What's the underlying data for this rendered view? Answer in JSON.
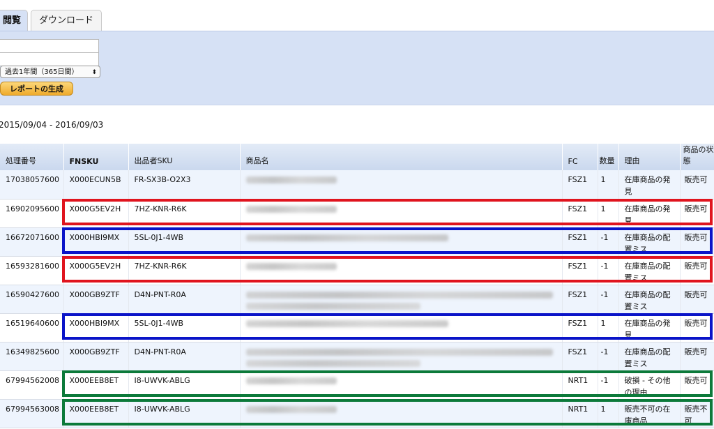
{
  "tabs": [
    {
      "label": "閲覧"
    },
    {
      "label": "ダウンロード"
    }
  ],
  "filters": {
    "period_select": "過去1年間（365日間）",
    "generate_button": "レポートの生成"
  },
  "date_range": "2015/09/04 - 2016/09/03",
  "table": {
    "headers": [
      "処理番号",
      "FNSKU",
      "出品者SKU",
      "商品名",
      "FC",
      "数量",
      "理由",
      "商品の状態"
    ],
    "rows": [
      {
        "id": "17038057600",
        "fnsku": "X000ECUN5B",
        "sku": "FR-SX3B-O2X3",
        "fc": "FSZ1",
        "qty": "1",
        "reason": "在庫商品の発見",
        "status": "販売可",
        "highlight": "none"
      },
      {
        "id": "16902095600",
        "fnsku": "X000G5EV2H",
        "sku": "7HZ-KNR-R6K",
        "fc": "FSZ1",
        "qty": "1",
        "reason": "在庫商品の発見",
        "status": "販売可",
        "highlight": "red"
      },
      {
        "id": "16672071600",
        "fnsku": "X000HBI9MX",
        "sku": "5SL-0J1-4WB",
        "fc": "FSZ1",
        "qty": "-1",
        "reason": "在庫商品の配置ミス",
        "status": "販売可",
        "highlight": "blue"
      },
      {
        "id": "16593281600",
        "fnsku": "X000G5EV2H",
        "sku": "7HZ-KNR-R6K",
        "fc": "FSZ1",
        "qty": "-1",
        "reason": "在庫商品の配置ミス",
        "status": "販売可",
        "highlight": "red"
      },
      {
        "id": "16590427600",
        "fnsku": "X000GB9ZTF",
        "sku": "D4N-PNT-R0A",
        "fc": "FSZ1",
        "qty": "-1",
        "reason": "在庫商品の配置ミス",
        "status": "販売可",
        "highlight": "none"
      },
      {
        "id": "16519640600",
        "fnsku": "X000HBI9MX",
        "sku": "5SL-0J1-4WB",
        "fc": "FSZ1",
        "qty": "1",
        "reason": "在庫商品の発見",
        "status": "販売可",
        "highlight": "blue"
      },
      {
        "id": "16349825600",
        "fnsku": "X000GB9ZTF",
        "sku": "D4N-PNT-R0A",
        "fc": "FSZ1",
        "qty": "-1",
        "reason": "在庫商品の配置ミス",
        "status": "販売可",
        "highlight": "none"
      },
      {
        "id": "67994562008",
        "fnsku": "X000EEB8ET",
        "sku": "I8-UWVK-ABLG",
        "fc": "NRT1",
        "qty": "-1",
        "reason": "破損 - その他の理由",
        "status": "販売可",
        "highlight": "green"
      },
      {
        "id": "67994563008",
        "fnsku": "X000EEB8ET",
        "sku": "I8-UWVK-ABLG",
        "fc": "NRT1",
        "qty": "1",
        "reason": "販売不可の在庫商品",
        "status": "販売不可",
        "highlight": "green"
      }
    ]
  },
  "colors": {
    "red": "#e0141e",
    "blue": "#0a14c8",
    "green": "#0c7a3a",
    "panel": "#d6e1f5"
  }
}
